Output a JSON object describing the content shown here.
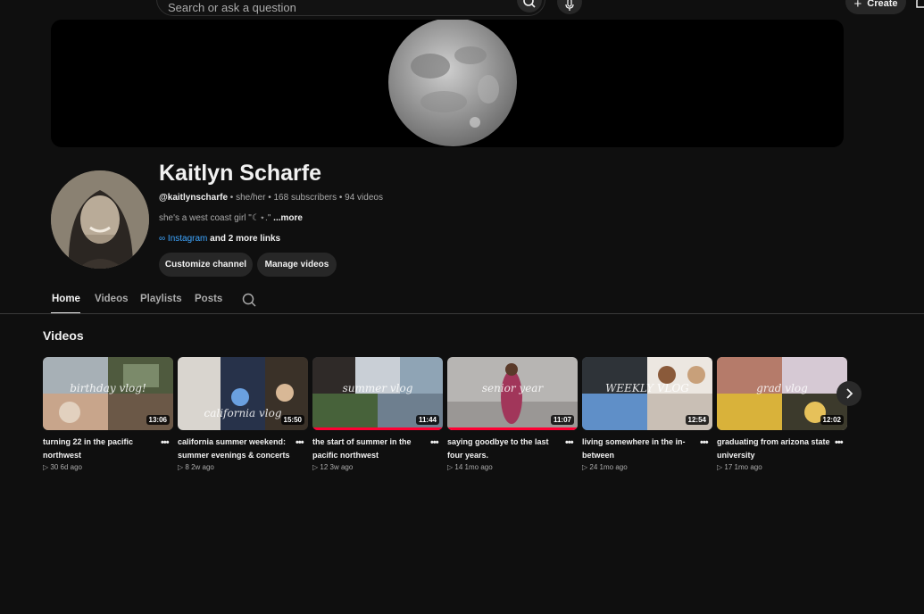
{
  "search": {
    "placeholder": "Search or ask a question"
  },
  "header": {
    "create_label": "Create"
  },
  "channel": {
    "name": "Kaitlyn Scharfe",
    "handle": "@kaitlynscharfe",
    "pronouns": "she/her",
    "subscribers": "168 subscribers",
    "video_count": "94 videos",
    "description": "she's a west coast girl \"☾⋆.\"",
    "more_label": "...more",
    "link_label": "Instagram",
    "more_links": "and 2 more links",
    "customize_label": "Customize channel",
    "manage_label": "Manage videos"
  },
  "tabs": [
    {
      "label": "Home",
      "active": true
    },
    {
      "label": "Videos",
      "active": false
    },
    {
      "label": "Playlists",
      "active": false
    },
    {
      "label": "Posts",
      "active": false
    }
  ],
  "section": {
    "title": "Videos"
  },
  "videos": [
    {
      "title": "turning 22 in the pacific northwest",
      "views": "30",
      "age": "6d ago",
      "duration": "13:06",
      "overlay": "birthday vlog!"
    },
    {
      "title": "california summer weekend: summer evenings & concerts",
      "views": "8",
      "age": "2w ago",
      "duration": "15:50",
      "overlay": "california vlog"
    },
    {
      "title": "the start of summer in the pacific northwest",
      "views": "12",
      "age": "3w ago",
      "duration": "11:44",
      "overlay": "summer vlog"
    },
    {
      "title": "saying goodbye to the last four years.",
      "views": "14",
      "age": "1mo ago",
      "duration": "11:07",
      "overlay": "senior year"
    },
    {
      "title": "living somewhere in the in-between",
      "views": "24",
      "age": "1mo ago",
      "duration": "12:54",
      "overlay": "WEEKLY VLOG"
    },
    {
      "title": "graduating from arizona state university",
      "views": "17",
      "age": "1mo ago",
      "duration": "12:02",
      "overlay": "grad vlog"
    }
  ],
  "colors": {
    "background": "#0f0f0f",
    "link": "#3ea6ff",
    "progress": "#ff0033",
    "pill": "#272727"
  }
}
